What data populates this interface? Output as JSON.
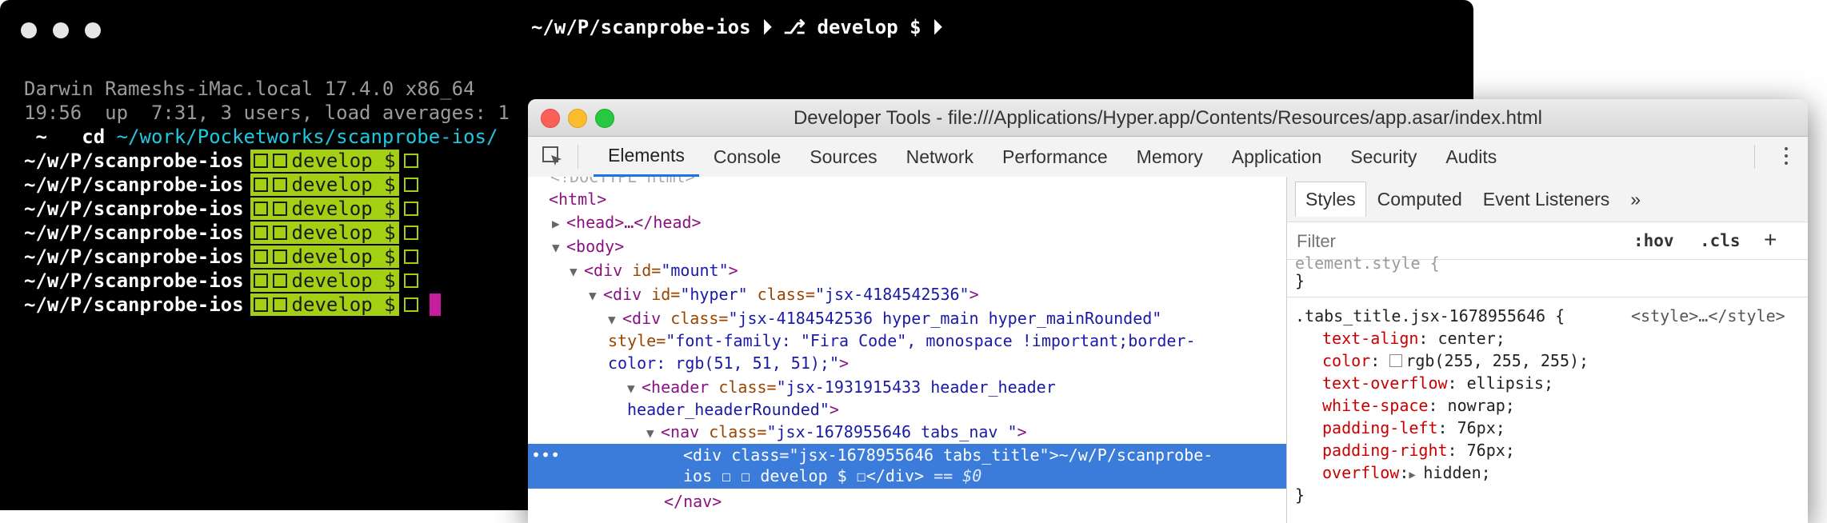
{
  "terminal": {
    "title": "~/w/P/scanprobe-ios ⏵ ⎇ develop $ ⏵",
    "lines": [
      "Darwin Rameshs-iMac.local 17.4.0 x86_64",
      "19:56  up  7:31, 3 users, load averages: 1"
    ],
    "cd_prefix": " ~   cd ",
    "cd_path": "~/work/Pocketworks/scanprobe-ios/",
    "prompts": [
      {
        "path": "~/w/P/scanprobe-ios",
        "branch": "develop $"
      },
      {
        "path": "~/w/P/scanprobe-ios",
        "branch": "develop $"
      },
      {
        "path": "~/w/P/scanprobe-ios",
        "branch": "develop $"
      },
      {
        "path": "~/w/P/scanprobe-ios",
        "branch": "develop $"
      },
      {
        "path": "~/w/P/scanprobe-ios",
        "branch": "develop $"
      },
      {
        "path": "~/w/P/scanprobe-ios",
        "branch": "develop $"
      },
      {
        "path": "~/w/P/scanprobe-ios",
        "branch": "develop $"
      }
    ]
  },
  "devtools": {
    "title": "Developer Tools - file:///Applications/Hyper.app/Contents/Resources/app.asar/index.html",
    "tabs": [
      "Elements",
      "Console",
      "Sources",
      "Network",
      "Performance",
      "Memory",
      "Application",
      "Security",
      "Audits"
    ],
    "dom": {
      "doctype": "<!DOCTYPE html>",
      "html": "<html>",
      "head": "<head>…</head>",
      "body": "<body>",
      "div_mount_tag": "<div ",
      "div_mount_attr": "id=",
      "div_mount_val": "\"mount\"",
      "div_hyper_tag": "<div ",
      "div_hyper_attr1": "id=",
      "div_hyper_val1": "\"hyper\"",
      "div_hyper_attr2": " class=",
      "div_hyper_val2": "\"jsx-4184542536\"",
      "div_main_tag": "<div ",
      "div_main_attr": "class=",
      "div_main_val": "\"jsx-4184542536 hyper_main hyper_mainRounded\"",
      "div_main_style_attr": "style=",
      "div_main_style_val1": "\"font-family: \"Fira Code\", monospace !important;border-",
      "div_main_style_val2": "color: rgb(51, 51, 51);\"",
      "header_tag": "<header ",
      "header_attr": "class=",
      "header_val1": "\"jsx-1931915433 header_header",
      "header_val2": "header_headerRounded\"",
      "nav_tag": "<nav ",
      "nav_attr": "class=",
      "nav_val": "\"jsx-1678955646 tabs_nav \"",
      "sel_tag": "<div ",
      "sel_attr": "class=",
      "sel_val": "\"jsx-1678955646 tabs_title\"",
      "sel_text1": "~/w/P/scanprobe-",
      "sel_text2": "ios ☐ ☐ develop $ ☐",
      "sel_close": "</div>",
      "sel_eq": " == $0",
      "nav_close": "</nav>"
    },
    "styles": {
      "tabs": [
        "Styles",
        "Computed",
        "Event Listeners"
      ],
      "overflow_glyph": "»",
      "filter_placeholder": "Filter",
      "hov": ":hov",
      "cls": ".cls",
      "plus": "+",
      "element_style": "element.style {",
      "close_brace": "}",
      "selector": ".tabs_title.jsx-1678955646 {",
      "source": "<style>…</style>",
      "props": [
        {
          "name": "text-align",
          "value": "center;"
        },
        {
          "name": "color",
          "value": "rgb(255, 255, 255);"
        },
        {
          "name": "text-overflow",
          "value": "ellipsis;"
        },
        {
          "name": "white-space",
          "value": "nowrap;"
        },
        {
          "name": "padding-left",
          "value": "76px;"
        },
        {
          "name": "padding-right",
          "value": "76px;"
        },
        {
          "name": "overflow",
          "value": "hidden;"
        }
      ],
      "close_brace2": "}"
    }
  }
}
